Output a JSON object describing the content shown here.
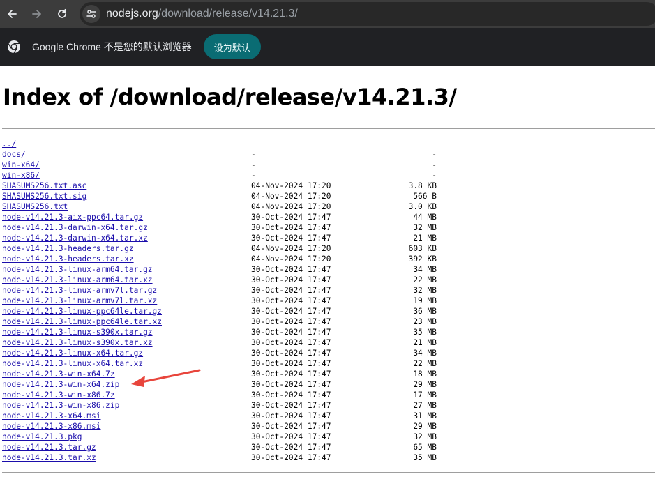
{
  "browser": {
    "url_host": "nodejs.org",
    "url_path": "/download/release/v14.21.3/"
  },
  "infobar": {
    "message": "Google Chrome 不是您的默认浏览器",
    "button_label": "设为默认"
  },
  "page": {
    "title": "Index of /download/release/v14.21.3/"
  },
  "listing": [
    {
      "name": "../",
      "date": "",
      "size": ""
    },
    {
      "name": "docs/",
      "date": "-",
      "size": "-"
    },
    {
      "name": "win-x64/",
      "date": "-",
      "size": "-"
    },
    {
      "name": "win-x86/",
      "date": "-",
      "size": "-"
    },
    {
      "name": "SHASUMS256.txt.asc",
      "date": "04-Nov-2024 17:20",
      "size": "3.8 KB"
    },
    {
      "name": "SHASUMS256.txt.sig",
      "date": "04-Nov-2024 17:20",
      "size": "566 B"
    },
    {
      "name": "SHASUMS256.txt",
      "date": "04-Nov-2024 17:20",
      "size": "3.0 KB"
    },
    {
      "name": "node-v14.21.3-aix-ppc64.tar.gz",
      "date": "30-Oct-2024 17:47",
      "size": "44 MB"
    },
    {
      "name": "node-v14.21.3-darwin-x64.tar.gz",
      "date": "30-Oct-2024 17:47",
      "size": "32 MB"
    },
    {
      "name": "node-v14.21.3-darwin-x64.tar.xz",
      "date": "30-Oct-2024 17:47",
      "size": "21 MB"
    },
    {
      "name": "node-v14.21.3-headers.tar.gz",
      "date": "04-Nov-2024 17:20",
      "size": "603 KB"
    },
    {
      "name": "node-v14.21.3-headers.tar.xz",
      "date": "04-Nov-2024 17:20",
      "size": "392 KB"
    },
    {
      "name": "node-v14.21.3-linux-arm64.tar.gz",
      "date": "30-Oct-2024 17:47",
      "size": "34 MB"
    },
    {
      "name": "node-v14.21.3-linux-arm64.tar.xz",
      "date": "30-Oct-2024 17:47",
      "size": "22 MB"
    },
    {
      "name": "node-v14.21.3-linux-armv7l.tar.gz",
      "date": "30-Oct-2024 17:47",
      "size": "32 MB"
    },
    {
      "name": "node-v14.21.3-linux-armv7l.tar.xz",
      "date": "30-Oct-2024 17:47",
      "size": "19 MB"
    },
    {
      "name": "node-v14.21.3-linux-ppc64le.tar.gz",
      "date": "30-Oct-2024 17:47",
      "size": "36 MB"
    },
    {
      "name": "node-v14.21.3-linux-ppc64le.tar.xz",
      "date": "30-Oct-2024 17:47",
      "size": "23 MB"
    },
    {
      "name": "node-v14.21.3-linux-s390x.tar.gz",
      "date": "30-Oct-2024 17:47",
      "size": "35 MB"
    },
    {
      "name": "node-v14.21.3-linux-s390x.tar.xz",
      "date": "30-Oct-2024 17:47",
      "size": "21 MB"
    },
    {
      "name": "node-v14.21.3-linux-x64.tar.gz",
      "date": "30-Oct-2024 17:47",
      "size": "34 MB"
    },
    {
      "name": "node-v14.21.3-linux-x64.tar.xz",
      "date": "30-Oct-2024 17:47",
      "size": "22 MB"
    },
    {
      "name": "node-v14.21.3-win-x64.7z",
      "date": "30-Oct-2024 17:47",
      "size": "18 MB"
    },
    {
      "name": "node-v14.21.3-win-x64.zip",
      "date": "30-Oct-2024 17:47",
      "size": "29 MB"
    },
    {
      "name": "node-v14.21.3-win-x86.7z",
      "date": "30-Oct-2024 17:47",
      "size": "17 MB"
    },
    {
      "name": "node-v14.21.3-win-x86.zip",
      "date": "30-Oct-2024 17:47",
      "size": "27 MB"
    },
    {
      "name": "node-v14.21.3-x64.msi",
      "date": "30-Oct-2024 17:47",
      "size": "31 MB"
    },
    {
      "name": "node-v14.21.3-x86.msi",
      "date": "30-Oct-2024 17:47",
      "size": "29 MB"
    },
    {
      "name": "node-v14.21.3.pkg",
      "date": "30-Oct-2024 17:47",
      "size": "32 MB"
    },
    {
      "name": "node-v14.21.3.tar.gz",
      "date": "30-Oct-2024 17:47",
      "size": "65 MB"
    },
    {
      "name": "node-v14.21.3.tar.xz",
      "date": "30-Oct-2024 17:47",
      "size": "35 MB"
    }
  ],
  "annotation": {
    "arrow_color": "#e8453c",
    "arrow_target": "node-v14.21.3-win-x64.zip"
  },
  "icons": {
    "back": "back-arrow-icon",
    "forward": "forward-arrow-icon",
    "reload": "reload-icon",
    "site_info": "tune-icon",
    "chrome": "chrome-logo-icon"
  }
}
